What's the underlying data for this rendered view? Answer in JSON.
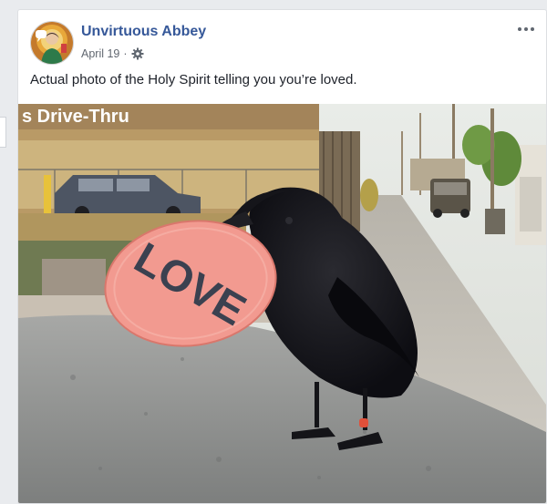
{
  "post": {
    "page_name": "Unvirtuous Abbey",
    "date": "April 19",
    "date_separator": "·",
    "privacy_icon": "gear-icon",
    "more_icon": "more-options-icon",
    "caption": "Actual photo of the Holy Spirit telling you you’re loved."
  },
  "photo": {
    "sign_text": "s Drive-Thru",
    "badge_text": "LOVE"
  },
  "colors": {
    "page_name": "#365899",
    "badge": "#f08f86",
    "background": "#e9ebee"
  }
}
